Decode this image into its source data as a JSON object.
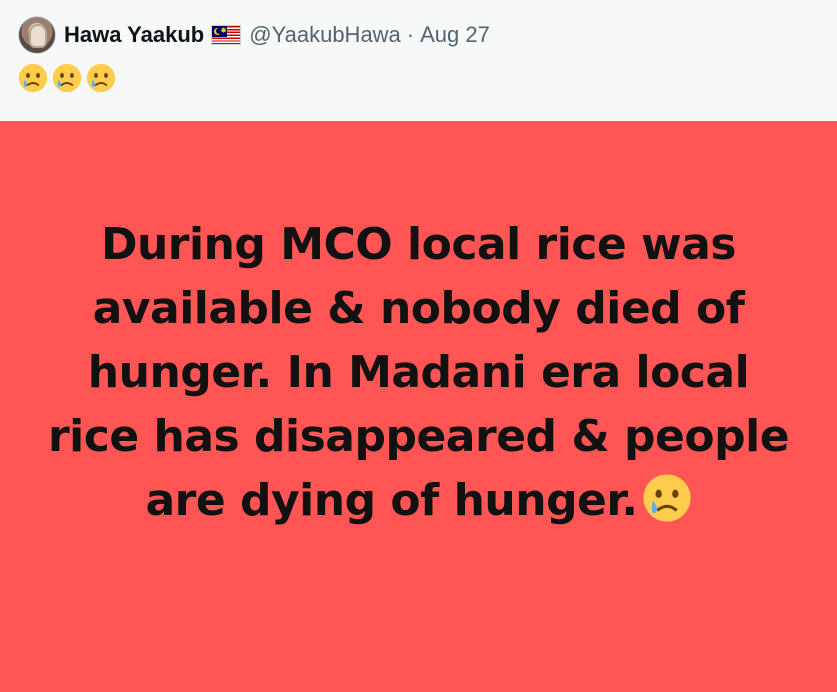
{
  "tweet": {
    "author": {
      "display_name": "Hawa Yaakub",
      "flag_icon": "malaysia-flag-icon",
      "handle": "@YaakubHawa",
      "separator": "·",
      "date": "Aug 27"
    },
    "text_emojis": [
      "crying-face-emoji",
      "crying-face-emoji",
      "crying-face-emoji"
    ],
    "media": {
      "background_color": "#ff5555",
      "text": "During MCO local rice was available & nobody died of hunger. In Madani era local rice has disappeared & people are dying of hunger.",
      "trailing_emoji": "crying-face-emoji"
    }
  }
}
